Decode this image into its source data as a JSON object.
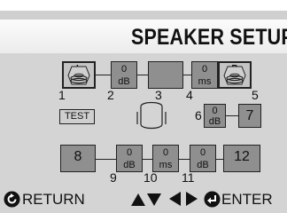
{
  "header": {
    "title": "SPEAKER SETUP"
  },
  "front_row": {
    "left_speaker": {
      "letter": "L",
      "number": "1"
    },
    "left_level": {
      "value": "0",
      "unit": "dB",
      "number": "2"
    },
    "center": {
      "number": "3"
    },
    "delay": {
      "value": "0",
      "unit": "ms",
      "number": "4"
    },
    "right_speaker": {
      "letter": "R",
      "number": "5"
    }
  },
  "middle_row": {
    "test_button": "TEST",
    "right_level": {
      "value": "0",
      "unit": "dB",
      "number": "6"
    },
    "side_right": {
      "label": "7"
    }
  },
  "rear_row": {
    "rear_left": {
      "label": "8"
    },
    "level_a": {
      "value": "0",
      "unit": "dB",
      "number": "9"
    },
    "delay_b": {
      "value": "0",
      "unit": "ms",
      "number": "10"
    },
    "level_c": {
      "value": "0",
      "unit": "dB",
      "number": "11"
    },
    "rear_right": {
      "label": "12"
    }
  },
  "footer": {
    "return_label": "RETURN",
    "enter_label": "ENTER",
    "icons": [
      "return-icon",
      "up-down-arrows-icon",
      "left-right-arrows-icon",
      "enter-icon"
    ]
  }
}
